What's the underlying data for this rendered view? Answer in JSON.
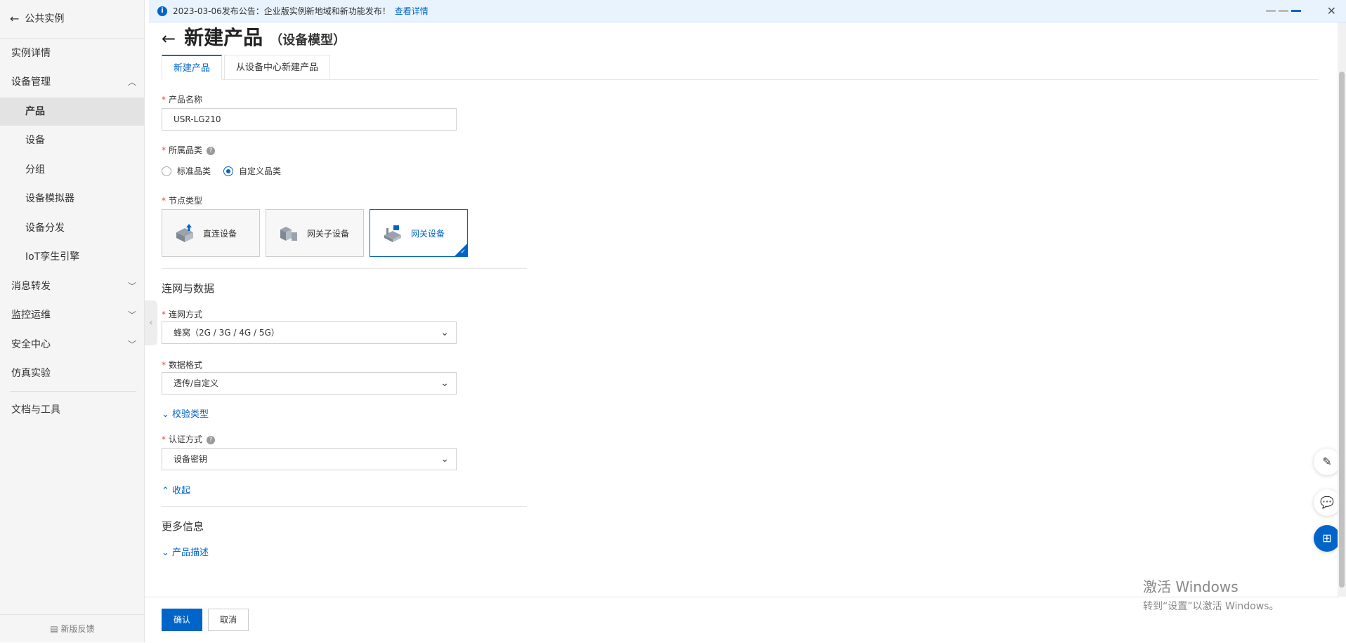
{
  "sidebar": {
    "back_label": "公共实例",
    "items": [
      {
        "label": "实例详情"
      },
      {
        "label": "设备管理"
      },
      {
        "label": "产品"
      },
      {
        "label": "设备"
      },
      {
        "label": "分组"
      },
      {
        "label": "设备模拟器"
      },
      {
        "label": "设备分发"
      },
      {
        "label": "IoT孪生引擎"
      },
      {
        "label": "消息转发"
      },
      {
        "label": "监控运维"
      },
      {
        "label": "安全中心"
      },
      {
        "label": "仿真实验"
      },
      {
        "label": "文档与工具"
      }
    ],
    "feedback": "新版反馈"
  },
  "notice": {
    "text": "2023-03-06发布公告：企业版实例新地域和新功能发布！",
    "link": "查看详情"
  },
  "page": {
    "title": "新建产品",
    "subtitle": "（设备模型）",
    "tabs": [
      {
        "label": "新建产品"
      },
      {
        "label": "从设备中心新建产品"
      }
    ]
  },
  "form": {
    "product_name": {
      "label": "产品名称",
      "value": "USR-LG210"
    },
    "category": {
      "label": "所属品类",
      "options": [
        "标准品类",
        "自定义品类"
      ],
      "selected": "自定义品类"
    },
    "node_type": {
      "label": "节点类型",
      "options": [
        "直连设备",
        "网关子设备",
        "网关设备"
      ],
      "selected": "网关设备"
    },
    "section_network": "连网与数据",
    "connect_method": {
      "label": "连网方式",
      "value": "蜂窝（2G / 3G / 4G / 5G）"
    },
    "data_format": {
      "label": "数据格式",
      "value": "透传/自定义"
    },
    "verify_type_toggle": "校验类型",
    "auth_method": {
      "label": "认证方式",
      "value": "设备密钥"
    },
    "collapse_toggle": "收起",
    "section_more": "更多信息",
    "product_desc_toggle": "产品描述"
  },
  "footer": {
    "confirm": "确认",
    "cancel": "取消"
  },
  "watermark": {
    "line1": "激活 Windows",
    "line2": "转到“设置”以激活 Windows。"
  },
  "colors": {
    "accent": "#0064c8",
    "required": "#e54545",
    "notice_bg": "#e9f3fd"
  }
}
